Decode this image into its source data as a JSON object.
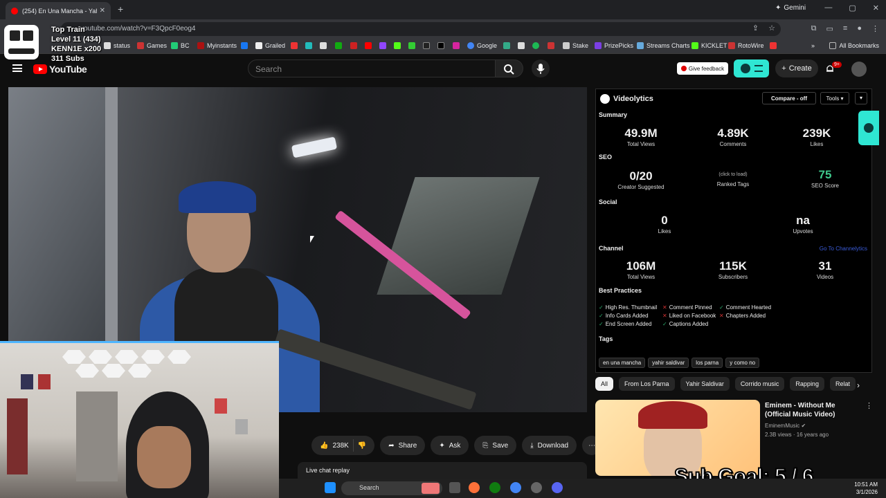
{
  "browser": {
    "tab_title": "(254) En Una Mancha - Yah...",
    "gemini_label": "Gemini",
    "url": "youtube.com/watch?v=F3QpcF0eog4",
    "bookmarks": [
      "status",
      "Games",
      "BC",
      "Myinstants",
      "Grailed",
      "Google",
      "Stake",
      "PrizePicks",
      "Streams Charts",
      "KICKLET",
      "RotoWire"
    ],
    "all_bookmarks": "All Bookmarks"
  },
  "stream_overlay": {
    "train_title": "Top Train",
    "level": "Level 11  (434)",
    "kennie": "KENN1E x200",
    "subs": "311 Subs",
    "sub_goal": "Sub Goal:  5 / 6"
  },
  "youtube": {
    "logo_text": "YouTube",
    "search_placeholder": "Search",
    "give_feedback": "Give feedback",
    "create": "Create",
    "notif_count": "9+"
  },
  "actions": {
    "likes": "238K",
    "share": "Share",
    "ask": "Ask",
    "save": "Save",
    "download": "Download",
    "live_chat": "Live chat replay"
  },
  "videolytics": {
    "title": "Videolytics",
    "compare": "Compare - off",
    "tools": "Tools",
    "summary_label": "Summary",
    "summary": [
      {
        "value": "49.9M",
        "label": "Total Views"
      },
      {
        "value": "4.89K",
        "label": "Comments"
      },
      {
        "value": "239K",
        "label": "Likes"
      }
    ],
    "seo_label": "SEO",
    "seo": {
      "creator_value": "0/20",
      "creator_label": "Creator Suggested",
      "tags_hint": "(click to load)",
      "tags_label": "Ranked Tags",
      "score_value": "75",
      "score_label": "SEO Score"
    },
    "social_label": "Social",
    "social": {
      "likes_value": "0",
      "likes_label": "Likes",
      "upvotes_value": "na",
      "upvotes_label": "Upvotes"
    },
    "channel_label": "Channel",
    "channel_link": "Go To Channelytics",
    "channel": [
      {
        "value": "106M",
        "label": "Total Views"
      },
      {
        "value": "115K",
        "label": "Subscribers"
      },
      {
        "value": "31",
        "label": "Videos"
      }
    ],
    "best_label": "Best Practices",
    "best": [
      {
        "text": "High Res. Thumbnail",
        "ok": true
      },
      {
        "text": "Comment Pinned",
        "ok": false
      },
      {
        "text": "Comment Hearted",
        "ok": true
      },
      {
        "text": "Info Cards Added",
        "ok": true
      },
      {
        "text": "Liked on Facebook",
        "ok": false
      },
      {
        "text": "Chapters Added",
        "ok": false
      },
      {
        "text": "End Screen Added",
        "ok": true
      },
      {
        "text": "Captions Added",
        "ok": true
      }
    ],
    "tags_label": "Tags",
    "tags": [
      "en una mancha",
      "yahir saldivar",
      "los parna",
      "y como no"
    ]
  },
  "chips": [
    "All",
    "From Los Parna",
    "Yahir Saldivar",
    "Corrido music",
    "Rapping",
    "Relat"
  ],
  "recommendation": {
    "title": "Eminem - Without Me (Official Music Video)",
    "channel": "EminemMusic",
    "meta": "2.3B views · 16 years ago"
  },
  "taskbar": {
    "search": "Search",
    "time": "10:51 AM",
    "date": "3/1/2026"
  }
}
